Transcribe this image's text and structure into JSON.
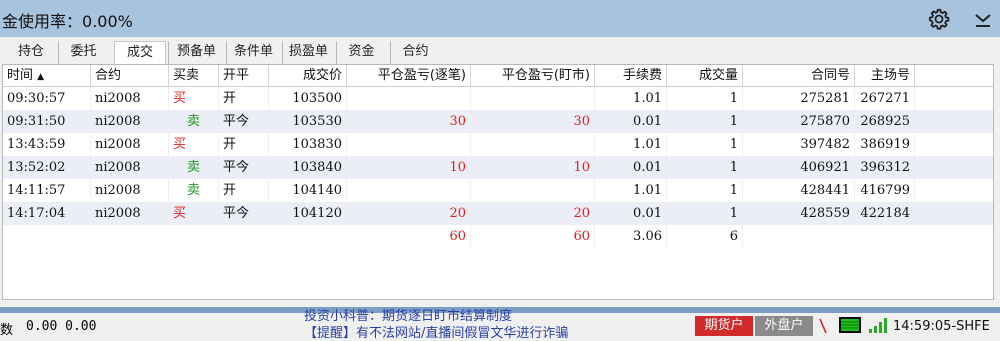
{
  "header": {
    "title": "金使用率：",
    "value": "0.00%",
    "icons": [
      "gear-icon",
      "collapse-icon"
    ]
  },
  "tabs": [
    "持仓",
    "委托",
    "成交",
    "预备单",
    "条件单",
    "损盈单",
    "资金",
    "合约"
  ],
  "active_tab": "成交",
  "table": {
    "columns": [
      "时间",
      "合约",
      "买卖",
      "开平",
      "成交价",
      "平仓盈亏(逐笔)",
      "平仓盈亏(盯市)",
      "手续费",
      "成交量",
      "合同号",
      "主场号"
    ],
    "sort_indicator": "▲",
    "rows": [
      {
        "time": "09:30:57",
        "contract": "ni2008",
        "side": "买",
        "oc": "开",
        "price": "103500",
        "pnl_trade": "",
        "pnl_mtm": "",
        "fee": "1.01",
        "vol": "1",
        "contract_no": "275281",
        "exchange_no": "267271"
      },
      {
        "time": "09:31:50",
        "contract": "ni2008",
        "side": "卖",
        "oc": "平今",
        "price": "103530",
        "pnl_trade": "30",
        "pnl_mtm": "30",
        "fee": "0.01",
        "vol": "1",
        "contract_no": "275870",
        "exchange_no": "268925"
      },
      {
        "time": "13:43:59",
        "contract": "ni2008",
        "side": "买",
        "oc": "开",
        "price": "103830",
        "pnl_trade": "",
        "pnl_mtm": "",
        "fee": "1.01",
        "vol": "1",
        "contract_no": "397482",
        "exchange_no": "386919"
      },
      {
        "time": "13:52:02",
        "contract": "ni2008",
        "side": "卖",
        "oc": "平今",
        "price": "103840",
        "pnl_trade": "10",
        "pnl_mtm": "10",
        "fee": "0.01",
        "vol": "1",
        "contract_no": "406921",
        "exchange_no": "396312"
      },
      {
        "time": "14:11:57",
        "contract": "ni2008",
        "side": "卖",
        "oc": "开",
        "price": "104140",
        "pnl_trade": "",
        "pnl_mtm": "",
        "fee": "1.01",
        "vol": "1",
        "contract_no": "428441",
        "exchange_no": "416799"
      },
      {
        "time": "14:17:04",
        "contract": "ni2008",
        "side": "买",
        "oc": "平今",
        "price": "104120",
        "pnl_trade": "20",
        "pnl_mtm": "20",
        "fee": "0.01",
        "vol": "1",
        "contract_no": "428559",
        "exchange_no": "422184"
      }
    ],
    "totals": {
      "pnl_trade": "60",
      "pnl_mtm": "60",
      "fee": "3.06",
      "vol": "6"
    }
  },
  "status": {
    "label": "数",
    "values": "0.00 0.00",
    "ticker_line1": "投资小科普：期货逐日盯市结算制度",
    "ticker_line2": "【提醒】有不法网站/直播间假冒文华进行诈骗",
    "btn_futures": "期货户",
    "btn_external": "外盘户",
    "time": "14:59:05-SHFE"
  },
  "colors": {
    "titlebar": "#a8c3dd",
    "buy": "#e02020",
    "sell": "#1a9a1a",
    "profit": "#e02020",
    "alt_row": "#ebeef6",
    "futures_btn": "#d02a2a",
    "external_btn": "#8a8a8a",
    "ticker_text": "#2a3fa8"
  }
}
